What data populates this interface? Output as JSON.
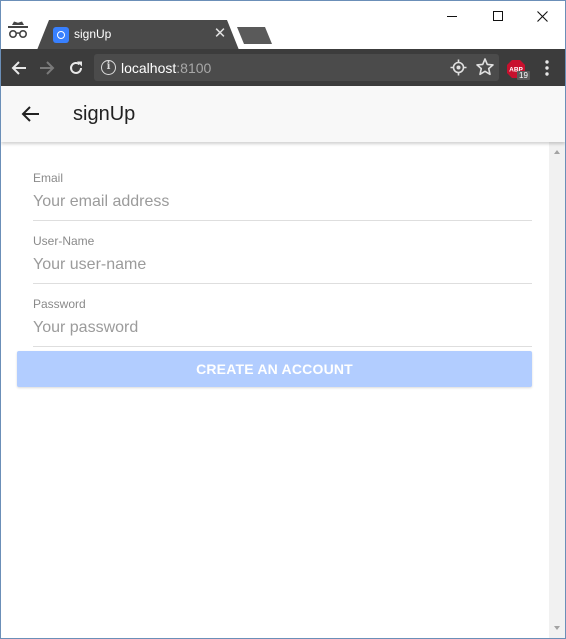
{
  "browser": {
    "tab": {
      "title": "signUp"
    },
    "address": {
      "host": "localhost",
      "port": ":8100"
    },
    "extension_badge": {
      "name": "ABP",
      "count": "19"
    }
  },
  "app": {
    "header": {
      "title": "signUp"
    },
    "form": {
      "email": {
        "label": "Email",
        "placeholder": "Your email address",
        "value": ""
      },
      "username": {
        "label": "User-Name",
        "placeholder": "Your user-name",
        "value": ""
      },
      "password": {
        "label": "Password",
        "placeholder": "Your password",
        "value": ""
      },
      "submit_label": "CREATE AN ACCOUNT"
    }
  },
  "colors": {
    "accent": "#3880ff",
    "button_disabled": "#b2cdff",
    "toolbar": "#3c3c3c",
    "tab_active": "#4a4a4a"
  },
  "icons": {
    "incognito": "incognito-icon",
    "back": "arrow-left-icon",
    "forward": "arrow-right-icon",
    "reload": "reload-icon",
    "info": "info-icon",
    "location": "location-target-icon",
    "bookmark": "star-icon",
    "menu": "three-dots-icon"
  }
}
